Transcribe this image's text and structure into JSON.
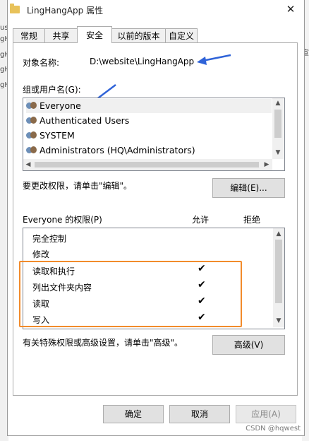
{
  "window": {
    "title": "LingHangApp 属性",
    "close_glyph": "✕"
  },
  "background_fragments": [
    "us",
    "gH",
    "gH",
    "gH",
    "gH"
  ],
  "right_fragment": "宣",
  "tabs": [
    {
      "label": "常规",
      "active": false
    },
    {
      "label": "共享",
      "active": false
    },
    {
      "label": "安全",
      "active": true
    },
    {
      "label": "以前的版本",
      "active": false
    },
    {
      "label": "自定义",
      "active": false
    }
  ],
  "object": {
    "label": "对象名称:",
    "value": "D:\\website\\LingHangApp"
  },
  "groups": {
    "label": "组或用户名(G):",
    "items": [
      {
        "name": "Everyone",
        "icon": "users-icon",
        "selected": true
      },
      {
        "name": "Authenticated Users",
        "icon": "users-icon",
        "selected": false
      },
      {
        "name": "SYSTEM",
        "icon": "users-icon",
        "selected": false
      },
      {
        "name": "Administrators (HQ\\Administrators)",
        "icon": "users-icon",
        "selected": false
      }
    ]
  },
  "edit": {
    "hint": "要更改权限，请单击\"编辑\"。",
    "button": "编辑(E)..."
  },
  "permissions": {
    "header": "Everyone 的权限(P)",
    "allow": "允许",
    "deny": "拒绝",
    "rows": [
      {
        "name": "完全控制",
        "allow": "",
        "deny": ""
      },
      {
        "name": "修改",
        "allow": "",
        "deny": ""
      },
      {
        "name": "读取和执行",
        "allow": "✔",
        "deny": ""
      },
      {
        "name": "列出文件夹内容",
        "allow": "✔",
        "deny": ""
      },
      {
        "name": "读取",
        "allow": "✔",
        "deny": ""
      },
      {
        "name": "写入",
        "allow": "✔",
        "deny": ""
      }
    ]
  },
  "advanced": {
    "hint": "有关特殊权限或高级设置，请单击\"高级\"。",
    "button": "高级(V)"
  },
  "footer": {
    "ok": "确定",
    "cancel": "取消",
    "apply": "应用(A)"
  },
  "watermark": "CSDN @hqwest",
  "colors": {
    "annotation_arrow": "#2f63d8",
    "highlight_box": "#f28b2b",
    "selected_row": "#f0f0f0"
  }
}
